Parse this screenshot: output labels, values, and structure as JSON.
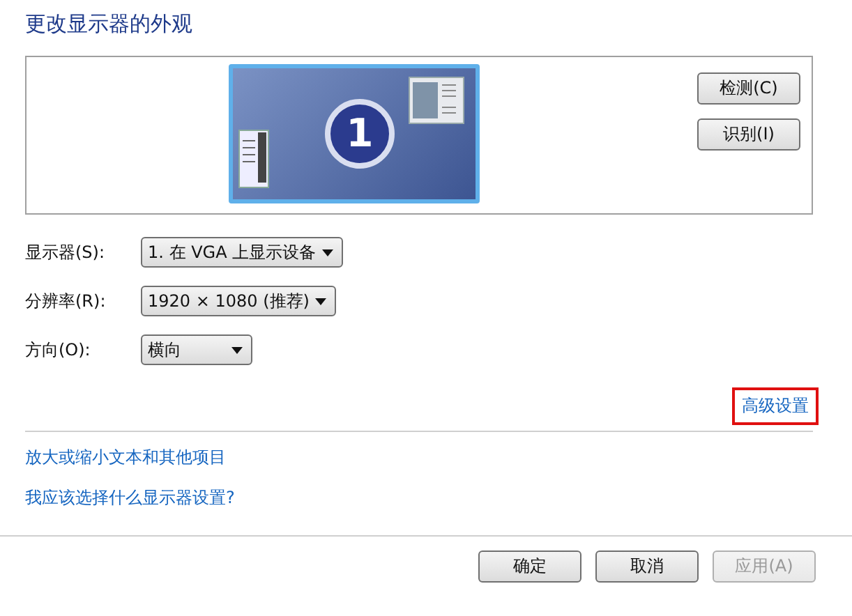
{
  "title": "更改显示器的外观",
  "preview": {
    "monitor_number": "1",
    "buttons": [
      {
        "label": "检测(C)"
      },
      {
        "label": "识别(I)"
      }
    ]
  },
  "settings": [
    {
      "label": "显示器(S):",
      "value": "1. 在 VGA 上显示设备"
    },
    {
      "label": "分辨率(R):",
      "value": "1920 × 1080 (推荐)"
    },
    {
      "label": "方向(O):",
      "value": "横向"
    }
  ],
  "advanced_link": {
    "label": "高级设置",
    "highlighted": true
  },
  "links": [
    "放大或缩小文本和其他项目",
    "我应该选择什么显示器设置?"
  ],
  "buttons": [
    {
      "label": "确定",
      "disabled": false
    },
    {
      "label": "取消",
      "disabled": false
    },
    {
      "label": "应用(A)",
      "disabled": true
    }
  ]
}
